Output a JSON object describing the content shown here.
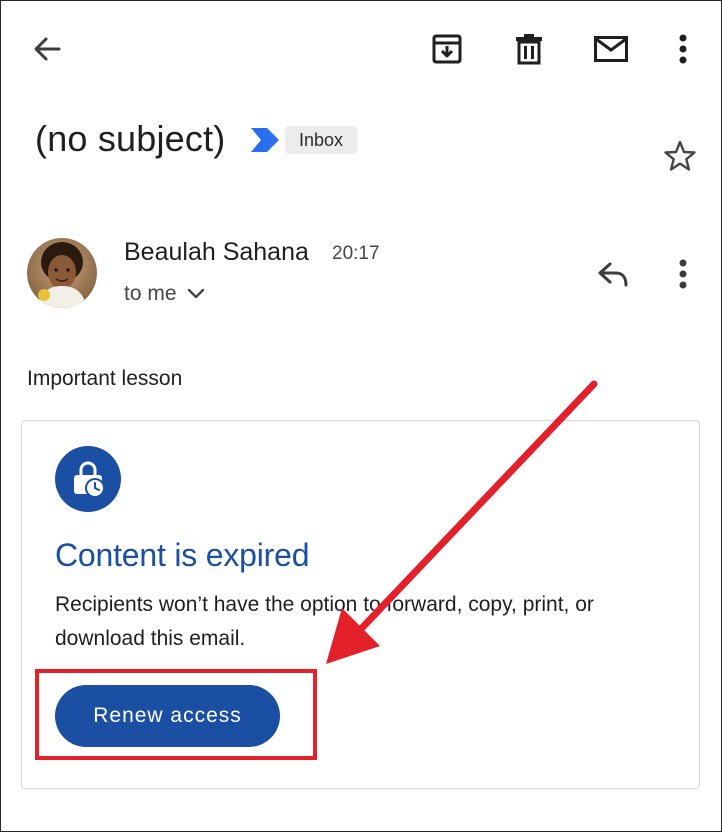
{
  "toolbar": {
    "back_icon": "arrow-left-icon",
    "archive_icon": "archive-icon",
    "delete_icon": "trash-icon",
    "mark_unread_icon": "mail-icon",
    "more_icon": "more-vertical-icon"
  },
  "message": {
    "subject": "(no subject)",
    "label": "Inbox",
    "important_icon": "importance-marker-icon",
    "star_icon": "star-outline-icon",
    "sender_name": "Beaulah Sahana",
    "time": "20:17",
    "recipient": "to me",
    "body": "Important lesson"
  },
  "expired_card": {
    "title": "Content is expired",
    "description": "Recipients won’t have the option to forward, copy, print, or download this email.",
    "button": "Renew access",
    "icon": "expired-lock-clock-icon"
  },
  "colors": {
    "accent_blue": "#1a4fa3",
    "importance_blue": "#2a6ff0",
    "annotation_red": "#e4202a"
  }
}
